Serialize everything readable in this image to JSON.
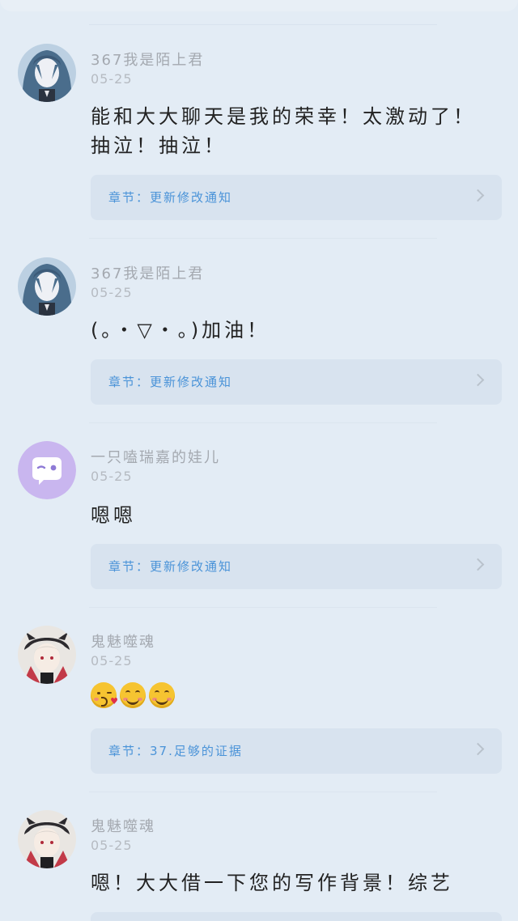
{
  "comments": [
    {
      "username": "367我是陌上君",
      "date": "05-25",
      "content": "能和大大聊天是我的荣幸！太激动了！抽泣！抽泣！",
      "chapter": "章节：更新修改通知",
      "avatar_icon": "anime-girl-blue-hair-avatar"
    },
    {
      "username": "367我是陌上君",
      "date": "05-25",
      "content": "(｡・▽・｡)加油！",
      "chapter": "章节：更新修改通知",
      "avatar_icon": "anime-girl-blue-hair-avatar"
    },
    {
      "username": "一只嗑瑞嘉的娃儿",
      "date": "05-25",
      "content": "嗯嗯",
      "chapter": "章节：更新修改通知",
      "avatar_icon": "default-chat-bubble-avatar"
    },
    {
      "username": "鬼魅噬魂",
      "date": "05-25",
      "content": "😘😊😊",
      "chapter": "章节：37.足够的证据",
      "avatar_icon": "anime-girl-dark-hood-avatar"
    },
    {
      "username": "鬼魅噬魂",
      "date": "05-25",
      "content": "嗯！大大借一下您的写作背景！综艺",
      "chapter": "",
      "avatar_icon": "anime-girl-dark-hood-avatar"
    }
  ],
  "colors": {
    "background": "#e3ecf5",
    "card": "#d8e3ef",
    "chapter_link": "#4a93d8",
    "username": "#a4a9b0",
    "default_avatar": "#c9b6ef"
  }
}
